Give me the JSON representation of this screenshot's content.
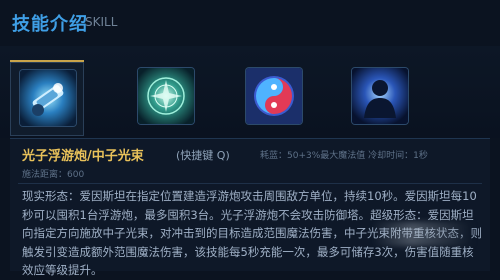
{
  "header": {
    "title_cn": "技能介绍",
    "title_en": "SKILL"
  },
  "skills": [
    {
      "icon": "cannon-icon",
      "active": true
    },
    {
      "icon": "rune-orb-icon",
      "active": false
    },
    {
      "icon": "swirl-icon",
      "active": false
    },
    {
      "icon": "silhouette-icon",
      "active": false
    }
  ],
  "detail": {
    "name": "光子浮游炮/中子光束",
    "hotkey": "(快捷键 Q)",
    "cost": "耗蓝：50+3%最大魔法值 冷却时间：1秒",
    "range": "施法距离：600",
    "description": "现实形态：爱因斯坦在指定位置建造浮游炮攻击周围敌方单位，持续10秒。爱因斯坦每10秒可以囤积1台浮游炮，最多囤积3台。光子浮游炮不会攻击防御塔。超级形态：爱因斯坦向指定方向施放中子光束，对冲击到的目标造成范围魔法伤害，中子光束附带重核状态，则触发引变造成额外范围魔法伤害，该技能每5秒充能一次，最多可储存3次，伤害值随重核效应等级提升。"
  },
  "colors": {
    "accent": "#3f9fe6",
    "gold": "#e8c15a",
    "background": "#0b1320"
  }
}
